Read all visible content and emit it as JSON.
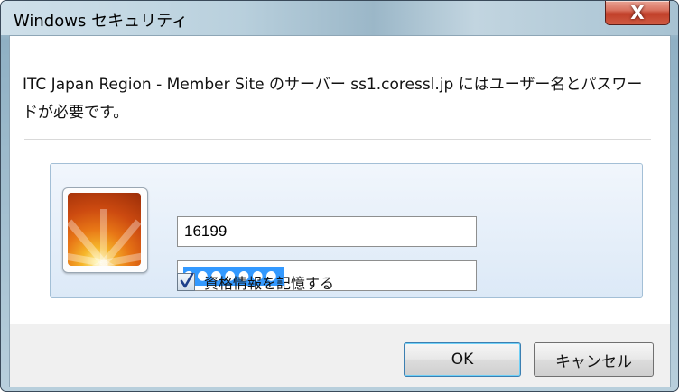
{
  "window": {
    "title": "Windows セキュリティ",
    "close_label": "X"
  },
  "dialog": {
    "message": "ITC Japan Region - Member Site のサーバー ss1.coressl.jp にはユーザー名とパスワードが必要です。"
  },
  "credentials": {
    "username_value": "16199",
    "password_mask": "●●●●●●●",
    "remember_label": "資格情報を記憶する",
    "remember_checked": true
  },
  "buttons": {
    "ok_label": "OK",
    "cancel_label": "キャンセル"
  },
  "colors": {
    "selection": "#3399ff",
    "close_button": "#c1402a"
  }
}
